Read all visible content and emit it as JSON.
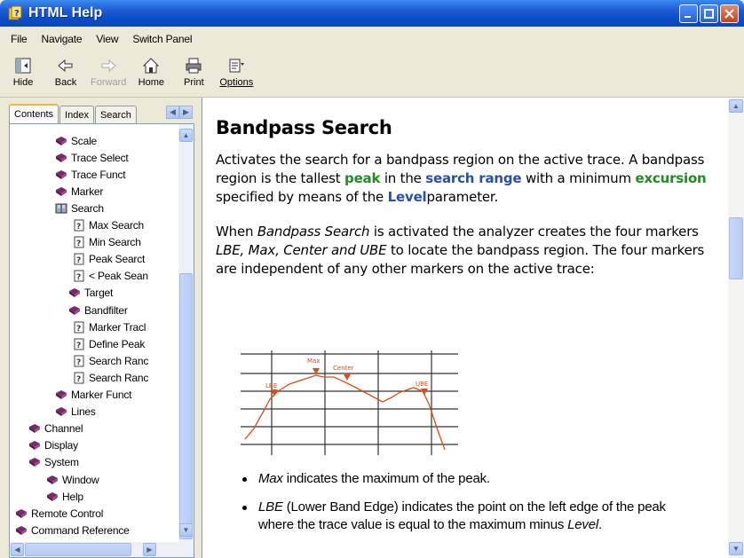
{
  "window": {
    "title": "HTML Help"
  },
  "menu": [
    "File",
    "Navigate",
    "View",
    "Switch Panel"
  ],
  "toolbar": [
    {
      "label": "Hide",
      "icon": "hide-icon",
      "enabled": true
    },
    {
      "label": "Back",
      "icon": "back-arrow-icon",
      "enabled": true
    },
    {
      "label": "Forward",
      "icon": "forward-arrow-icon",
      "enabled": false
    },
    {
      "label": "Home",
      "icon": "home-icon",
      "enabled": true
    },
    {
      "label": "Print",
      "icon": "printer-icon",
      "enabled": true
    },
    {
      "label": "Options",
      "icon": "options-icon",
      "enabled": true
    }
  ],
  "tabs": [
    "Contents",
    "Index",
    "Search"
  ],
  "tree": [
    {
      "label": "Scale",
      "icon": "book"
    },
    {
      "label": "Trace Select",
      "icon": "book"
    },
    {
      "label": "Trace Funct",
      "icon": "book"
    },
    {
      "label": "Marker",
      "icon": "book"
    },
    {
      "label": "Search",
      "icon": "open-book"
    },
    {
      "label": "Max Search",
      "icon": "page"
    },
    {
      "label": "Min Search",
      "icon": "page"
    },
    {
      "label": "Peak Searct",
      "icon": "page"
    },
    {
      "label": "< Peak Sean",
      "icon": "page"
    },
    {
      "label": "Target",
      "icon": "book"
    },
    {
      "label": "Bandfilter",
      "icon": "book"
    },
    {
      "label": "Marker Tracl",
      "icon": "page"
    },
    {
      "label": "Define Peak",
      "icon": "page"
    },
    {
      "label": "Search Ranc",
      "icon": "page"
    },
    {
      "label": "Search Ranc",
      "icon": "page"
    },
    {
      "label": "Marker Funct",
      "icon": "book"
    },
    {
      "label": "Lines",
      "icon": "book"
    },
    {
      "label": "Channel",
      "icon": "book"
    },
    {
      "label": "Display",
      "icon": "book"
    },
    {
      "label": "System",
      "icon": "book"
    },
    {
      "label": "Window",
      "icon": "book"
    },
    {
      "label": "Help",
      "icon": "book"
    },
    {
      "label": "Remote Control",
      "icon": "book"
    },
    {
      "label": "Command Reference",
      "icon": "book"
    }
  ],
  "doc": {
    "title": "Bandpass Search",
    "p1": {
      "t1": "Activates the search for a bandpass region on the active trace. A bandpass region is the tallest ",
      "k1": "peak",
      "t2": " in the ",
      "k2": "search range",
      "t3": " with a minimum ",
      "k3": "excursion",
      "t4": " specified by means of the ",
      "k4": "Level",
      "t5": "parameter."
    },
    "p2": {
      "t1": "When ",
      "e1": "Bandpass Search",
      "t2": " is activated the analyzer creates the four markers ",
      "e2": "LBE, Max, Center and UBE",
      "t3": " to locate the bandpass region. The four markers are independent of any other markers on the active trace:"
    },
    "diagram": {
      "lbe": "LBE",
      "max": "Max",
      "center": "Center",
      "ube": "UBE"
    },
    "b1": {
      "e": "Max",
      "t": " indicates the maximum of the peak."
    },
    "b2": {
      "e": "LBE",
      "t": " (Lower Band Edge) indicates the point on the left edge of the peak where the trace value is equal to the maximum minus ",
      "e2": "Level",
      "t2": "."
    }
  },
  "colors": {
    "title_bar": "#0a4cc8",
    "keyword_green": "#228b22",
    "keyword_blue": "#2a4fa6",
    "marker_red": "#e04a1a"
  }
}
